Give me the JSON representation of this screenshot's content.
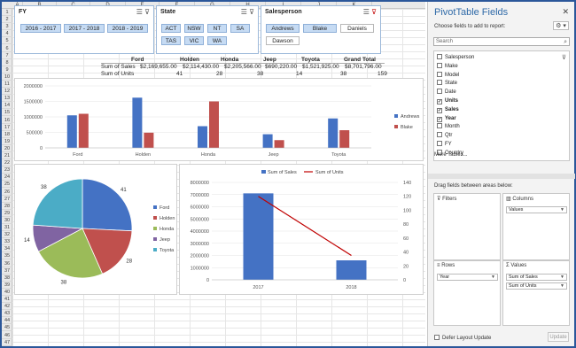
{
  "sheet": {
    "columns": [
      "A",
      "B",
      "C",
      "D",
      "E",
      "F",
      "G",
      "H",
      "I",
      "J",
      "K"
    ],
    "rows": [
      "1",
      "2",
      "3",
      "4",
      "5",
      "6",
      "7",
      "8",
      "9",
      "10",
      "11",
      "12",
      "13",
      "14",
      "15",
      "16",
      "17",
      "18",
      "19",
      "20",
      "21",
      "22",
      "23",
      "24",
      "25",
      "26",
      "27",
      "28",
      "29",
      "30",
      "31",
      "32",
      "33",
      "34",
      "35",
      "36",
      "37",
      "38",
      "39",
      "40",
      "41",
      "42",
      "43",
      "44",
      "45",
      "46",
      "47"
    ]
  },
  "slicers": {
    "fy": {
      "title": "FY",
      "items": [
        "2016 - 2017",
        "2017 - 2018",
        "2018 - 2019"
      ]
    },
    "state": {
      "title": "State",
      "items": [
        "ACT",
        "NSW",
        "NT",
        "SA",
        "TAS",
        "VIC",
        "WA"
      ]
    },
    "salesperson": {
      "title": "Salesperson",
      "items": [
        "Andrews",
        "Blake",
        "Daniels",
        "Dawson"
      ]
    }
  },
  "pivot": {
    "headers": [
      "Ford",
      "Holden",
      "Honda",
      "Jeep",
      "Toyota",
      "Grand Total"
    ],
    "rows": [
      {
        "label": "Sum of Sales",
        "values": [
          "$2,169,655.00",
          "$2,114,430.00",
          "$2,205,566.00",
          "$690,220.00",
          "$1,521,925.00",
          "$8,701,796.00"
        ]
      },
      {
        "label": "Sum of Units",
        "values": [
          "41",
          "28",
          "38",
          "14",
          "38",
          "159"
        ]
      }
    ]
  },
  "chart_data": [
    {
      "type": "bar",
      "categories": [
        "Ford",
        "Holden",
        "Honda",
        "Jeep",
        "Toyota"
      ],
      "series": [
        {
          "name": "Andrews",
          "values": [
            1050000,
            1620000,
            700000,
            440000,
            950000
          ],
          "color": "#4472c4"
        },
        {
          "name": "Blake",
          "values": [
            1100000,
            490000,
            1500000,
            250000,
            570000
          ],
          "color": "#c0504d"
        }
      ],
      "ylim": [
        0,
        2000000
      ],
      "yticks": [
        "2000000",
        "1500000",
        "1000000",
        "500000",
        "0"
      ],
      "legend": "right"
    },
    {
      "type": "pie",
      "categories": [
        "Ford",
        "Holden",
        "Honda",
        "Jeep",
        "Toyota"
      ],
      "values": [
        41,
        28,
        38,
        14,
        38
      ],
      "labels": [
        "41",
        "28",
        "38",
        "14",
        "38"
      ],
      "colors": [
        "#4472c4",
        "#c0504d",
        "#9bbb59",
        "#8064a2",
        "#4bacc6"
      ],
      "legend": "right"
    },
    {
      "type": "bar",
      "categories": [
        "2017",
        "2018"
      ],
      "series": [
        {
          "name": "Sum of Sales",
          "values": [
            7100000,
            1600000
          ],
          "color": "#4472c4"
        },
        {
          "name": "Sum of Units",
          "values": [
            120,
            35
          ],
          "color": "#c00000",
          "type": "line",
          "axis": "secondary"
        }
      ],
      "ylim": [
        0,
        8000000
      ],
      "yticks": [
        "8000000",
        "7000000",
        "6000000",
        "5000000",
        "4000000",
        "3000000",
        "2000000",
        "1000000",
        "0"
      ],
      "y2lim": [
        0,
        140
      ],
      "y2ticks": [
        "140",
        "120",
        "100",
        "80",
        "60",
        "40",
        "20",
        "0"
      ],
      "legend": "top"
    }
  ],
  "panel": {
    "title": "PivotTable Fields",
    "subtitle": "Choose fields to add to report:",
    "search_placeholder": "Search",
    "fields": [
      {
        "label": "Salesperson",
        "checked": false,
        "bold": false
      },
      {
        "label": "Make",
        "checked": false,
        "bold": false
      },
      {
        "label": "Model",
        "checked": false,
        "bold": false
      },
      {
        "label": "State",
        "checked": false,
        "bold": false
      },
      {
        "label": "Date",
        "checked": false,
        "bold": false
      },
      {
        "label": "Units",
        "checked": true,
        "bold": true
      },
      {
        "label": "Sales",
        "checked": true,
        "bold": true
      },
      {
        "label": "Year",
        "checked": true,
        "bold": true
      },
      {
        "label": "Month",
        "checked": false,
        "bold": false
      },
      {
        "label": "Qtr",
        "checked": false,
        "bold": false
      },
      {
        "label": "FY",
        "checked": false,
        "bold": false
      },
      {
        "label": "Country",
        "checked": false,
        "bold": false
      }
    ],
    "more_tables": "More Tables...",
    "drag_label": "Drag fields between areas below:",
    "areas": {
      "filters": {
        "label": "Filters",
        "items": []
      },
      "columns": {
        "label": "Columns",
        "items": [
          "Values"
        ]
      },
      "rows": {
        "label": "Rows",
        "items": [
          "Year"
        ]
      },
      "values": {
        "label": "Values",
        "items": [
          "Sum of Sales",
          "Sum of Units"
        ]
      }
    },
    "defer_label": "Defer Layout Update",
    "update_label": "Update"
  }
}
